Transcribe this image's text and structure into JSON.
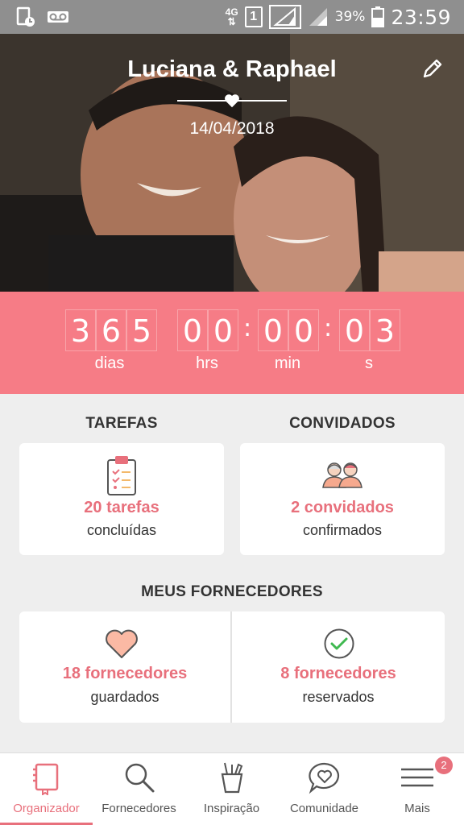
{
  "status_bar": {
    "network": "4G",
    "sim": "1",
    "battery": "39%",
    "time": "23:59"
  },
  "header": {
    "couple_title": "Luciana & Raphael",
    "wedding_date": "14/04/2018"
  },
  "countdown": {
    "days": [
      "3",
      "6",
      "5"
    ],
    "hours": [
      "0",
      "0"
    ],
    "minutes": [
      "0",
      "0"
    ],
    "seconds": [
      "0",
      "3"
    ],
    "labels": {
      "days": "dias",
      "hours": "hrs",
      "minutes": "min",
      "seconds": "s"
    }
  },
  "tasks": {
    "section": "TAREFAS",
    "count": "20 tarefas",
    "caption": "concluídas"
  },
  "guests": {
    "section": "CONVIDADOS",
    "count": "2 convidados",
    "caption": "confirmados"
  },
  "vendors": {
    "section": "MEUS FORNECEDORES",
    "saved_count": "18 fornecedores",
    "saved_caption": "guardados",
    "booked_count": "8 fornecedores",
    "booked_caption": "reservados"
  },
  "tabs": [
    {
      "label": "Organizador",
      "icon": "planner-book-icon",
      "active": true
    },
    {
      "label": "Fornecedores",
      "icon": "search-icon"
    },
    {
      "label": "Inspiração",
      "icon": "inspiration-cup-icon"
    },
    {
      "label": "Comunidade",
      "icon": "chat-heart-icon"
    },
    {
      "label": "Mais",
      "icon": "menu-icon",
      "badge": "2"
    }
  ],
  "colors": {
    "accent": "#e8707c",
    "countdown_bg": "#f67c86",
    "background": "#eeeeee"
  }
}
